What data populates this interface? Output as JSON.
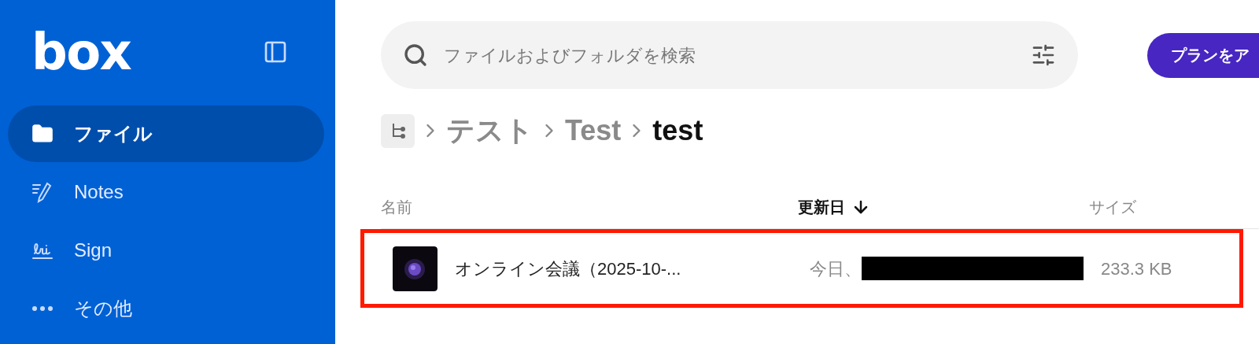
{
  "sidebar": {
    "logo": "box",
    "items": [
      {
        "label": "ファイル",
        "kind": "folder",
        "selected": true
      },
      {
        "label": "Notes",
        "kind": "notes",
        "selected": false
      },
      {
        "label": "Sign",
        "kind": "sign",
        "selected": false
      },
      {
        "label": "その他",
        "kind": "more",
        "selected": false
      }
    ]
  },
  "search": {
    "placeholder": "ファイルおよびフォルダを検索"
  },
  "upgrade_button": "プランをア",
  "breadcrumb": [
    {
      "label": "テスト",
      "current": false
    },
    {
      "label": "Test",
      "current": false
    },
    {
      "label": "test",
      "current": true
    }
  ],
  "table": {
    "columns": [
      {
        "label": "名前",
        "sorted": false
      },
      {
        "label": "更新日",
        "sorted": true
      },
      {
        "label": "サイズ",
        "sorted": false
      }
    ],
    "rows": [
      {
        "name": "オンライン会議（2025-10-...",
        "modified": "今日、",
        "redacted": true,
        "size": "233.3 KB",
        "highlighted": true
      }
    ]
  }
}
